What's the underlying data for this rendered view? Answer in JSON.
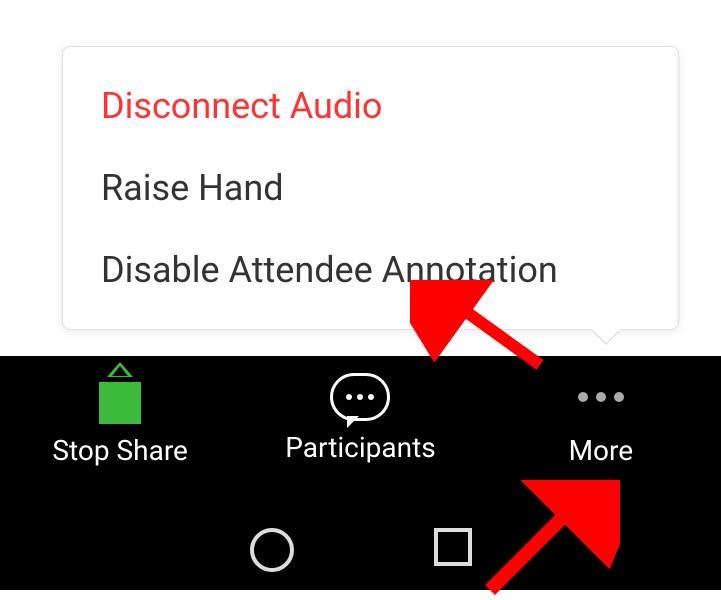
{
  "popup": {
    "items": [
      {
        "label": "Disconnect Audio",
        "danger": true
      },
      {
        "label": "Raise Hand",
        "danger": false
      },
      {
        "label": "Disable Attendee Annotation",
        "danger": false
      }
    ]
  },
  "toolbar": {
    "stop_share_label": "Stop Share",
    "participants_label": "Participants",
    "more_label": "More"
  },
  "colors": {
    "danger": "#ff3333",
    "share_green": "#3cba3c"
  }
}
